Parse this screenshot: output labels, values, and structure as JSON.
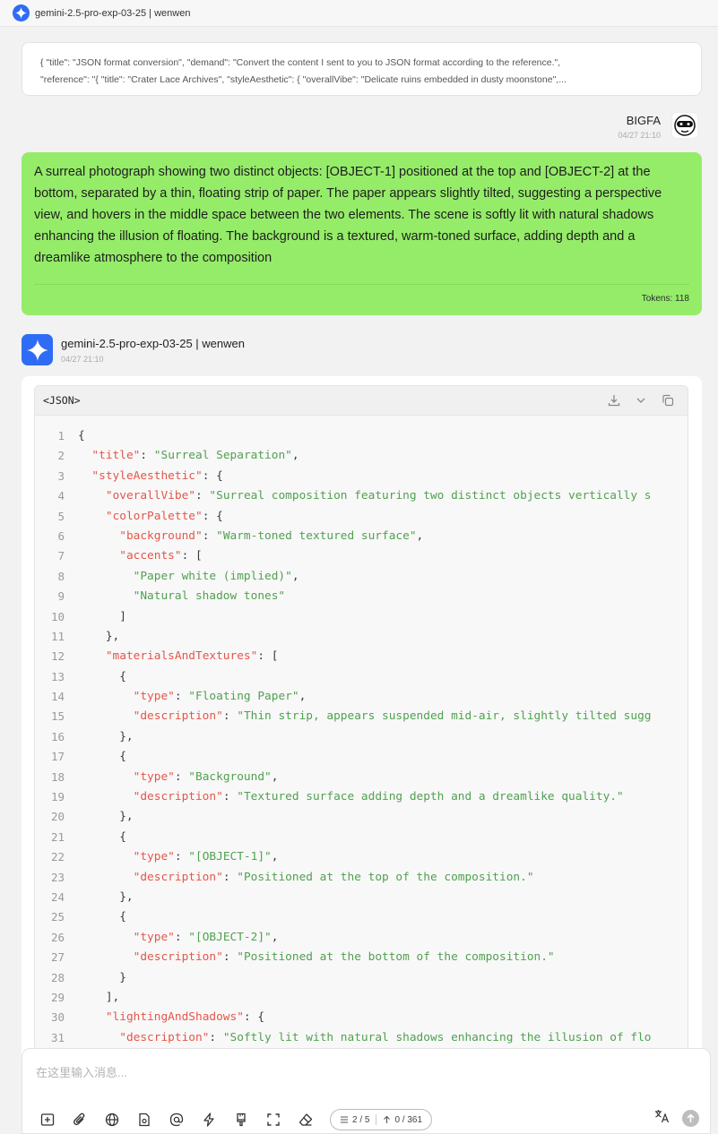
{
  "app": {
    "title": "gemini-2.5-pro-exp-03-25 | wenwen"
  },
  "reference_prompt": {
    "line1": "{ \"title\": \"JSON format conversion\", \"demand\": \"Convert the content I sent to you to JSON format according to the reference.\",",
    "line2": "\"reference\": \"{ \"title\": \"Crater Lace Archives\", \"styleAesthetic\": { \"overallVibe\": \"Delicate ruins embedded in dusty moonstone\",..."
  },
  "user_message": {
    "name": "BIGFA",
    "time": "04/27 21:10",
    "text": "A surreal photograph showing two distinct objects: [OBJECT-1] positioned at the top and [OBJECT-2] at the bottom, separated by a thin, floating strip of paper. The paper appears slightly tilted, suggesting a perspective view, and hovers in the middle space between the two elements. The scene is softly lit with natural shadows enhancing the illusion of floating. The background is a textured, warm-toned surface, adding depth and a dreamlike atmosphere to the composition",
    "tokens_label": "Tokens:",
    "tokens_value": "118"
  },
  "bot_message": {
    "name": "gemini-2.5-pro-exp-03-25 | wenwen",
    "time": "04/27 21:10",
    "code_lang": "<JSON>",
    "code_icons": [
      "download-icon",
      "chevron-down-icon",
      "copy-icon"
    ],
    "code_lines": [
      [
        [
          "p",
          "{"
        ]
      ],
      [
        [
          "p",
          "  "
        ],
        [
          "k",
          "\"title\""
        ],
        [
          "p",
          ": "
        ],
        [
          "s",
          "\"Surreal Separation\""
        ],
        [
          "p",
          ","
        ]
      ],
      [
        [
          "p",
          "  "
        ],
        [
          "k",
          "\"styleAesthetic\""
        ],
        [
          "p",
          ": {"
        ]
      ],
      [
        [
          "p",
          "    "
        ],
        [
          "k",
          "\"overallVibe\""
        ],
        [
          "p",
          ": "
        ],
        [
          "s",
          "\"Surreal composition featuring two distinct objects vertically s"
        ]
      ],
      [
        [
          "p",
          "    "
        ],
        [
          "k",
          "\"colorPalette\""
        ],
        [
          "p",
          ": {"
        ]
      ],
      [
        [
          "p",
          "      "
        ],
        [
          "k",
          "\"background\""
        ],
        [
          "p",
          ": "
        ],
        [
          "s",
          "\"Warm-toned textured surface\""
        ],
        [
          "p",
          ","
        ]
      ],
      [
        [
          "p",
          "      "
        ],
        [
          "k",
          "\"accents\""
        ],
        [
          "p",
          ": ["
        ]
      ],
      [
        [
          "p",
          "        "
        ],
        [
          "s",
          "\"Paper white (implied)\""
        ],
        [
          "p",
          ","
        ]
      ],
      [
        [
          "p",
          "        "
        ],
        [
          "s",
          "\"Natural shadow tones\""
        ]
      ],
      [
        [
          "p",
          "      ]"
        ]
      ],
      [
        [
          "p",
          "    },"
        ]
      ],
      [
        [
          "p",
          "    "
        ],
        [
          "k",
          "\"materialsAndTextures\""
        ],
        [
          "p",
          ": ["
        ]
      ],
      [
        [
          "p",
          "      {"
        ]
      ],
      [
        [
          "p",
          "        "
        ],
        [
          "k",
          "\"type\""
        ],
        [
          "p",
          ": "
        ],
        [
          "s",
          "\"Floating Paper\""
        ],
        [
          "p",
          ","
        ]
      ],
      [
        [
          "p",
          "        "
        ],
        [
          "k",
          "\"description\""
        ],
        [
          "p",
          ": "
        ],
        [
          "s",
          "\"Thin strip, appears suspended mid-air, slightly tilted sugg"
        ]
      ],
      [
        [
          "p",
          "      },"
        ]
      ],
      [
        [
          "p",
          "      {"
        ]
      ],
      [
        [
          "p",
          "        "
        ],
        [
          "k",
          "\"type\""
        ],
        [
          "p",
          ": "
        ],
        [
          "s",
          "\"Background\""
        ],
        [
          "p",
          ","
        ]
      ],
      [
        [
          "p",
          "        "
        ],
        [
          "k",
          "\"description\""
        ],
        [
          "p",
          ": "
        ],
        [
          "s",
          "\"Textured surface adding depth and a dreamlike quality.\""
        ]
      ],
      [
        [
          "p",
          "      },"
        ]
      ],
      [
        [
          "p",
          "      {"
        ]
      ],
      [
        [
          "p",
          "        "
        ],
        [
          "k",
          "\"type\""
        ],
        [
          "p",
          ": "
        ],
        [
          "s",
          "\"[OBJECT-1]\""
        ],
        [
          "p",
          ","
        ]
      ],
      [
        [
          "p",
          "        "
        ],
        [
          "k",
          "\"description\""
        ],
        [
          "p",
          ": "
        ],
        [
          "s",
          "\"Positioned at the top of the composition.\""
        ]
      ],
      [
        [
          "p",
          "      },"
        ]
      ],
      [
        [
          "p",
          "      {"
        ]
      ],
      [
        [
          "p",
          "        "
        ],
        [
          "k",
          "\"type\""
        ],
        [
          "p",
          ": "
        ],
        [
          "s",
          "\"[OBJECT-2]\""
        ],
        [
          "p",
          ","
        ]
      ],
      [
        [
          "p",
          "        "
        ],
        [
          "k",
          "\"description\""
        ],
        [
          "p",
          ": "
        ],
        [
          "s",
          "\"Positioned at the bottom of the composition.\""
        ]
      ],
      [
        [
          "p",
          "      }"
        ]
      ],
      [
        [
          "p",
          "    ],"
        ]
      ],
      [
        [
          "p",
          "    "
        ],
        [
          "k",
          "\"lightingAndShadows\""
        ],
        [
          "p",
          ": {"
        ]
      ],
      [
        [
          "p",
          "      "
        ],
        [
          "k",
          "\"description\""
        ],
        [
          "p",
          ": "
        ],
        [
          "s",
          "\"Softly lit with natural shadows enhancing the illusion of flo"
        ]
      ]
    ]
  },
  "composer": {
    "placeholder": "在这里输入消息...",
    "toolbar_icons": [
      "new-chat-icon",
      "attach-icon",
      "globe-icon",
      "file-icon",
      "mention-icon",
      "lightning-icon",
      "brush-icon",
      "fullscreen-icon",
      "eraser-icon"
    ],
    "context_count": "2 / 5",
    "token_count": "0 / 361",
    "right_icons": [
      "translate-icon",
      "send-icon"
    ]
  },
  "colors": {
    "user_bubble": "#95ec69",
    "brand_blue": "#2f6cf5",
    "json_key": "#e45649",
    "json_string": "#50a14f"
  }
}
